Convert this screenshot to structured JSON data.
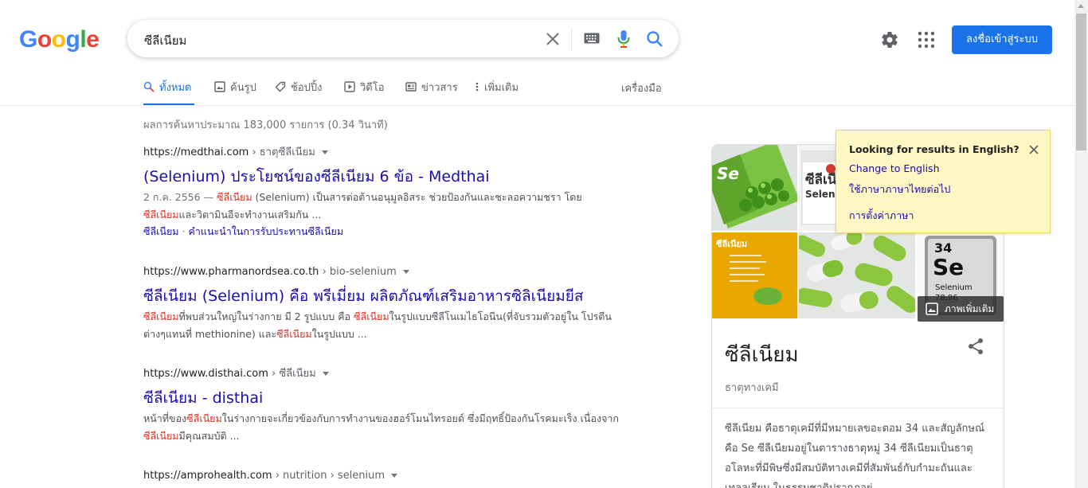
{
  "header": {
    "logo": [
      "G",
      "o",
      "o",
      "g",
      "l",
      "e"
    ],
    "logo_colors": [
      "#4285f4",
      "#ea4335",
      "#fbbc05",
      "#4285f4",
      "#34a853",
      "#ea4335"
    ],
    "query": "ซีลีเนียม",
    "signin_label": "ลงชื่อเข้าสู่ระบบ",
    "accent": "#1a73e8"
  },
  "tabs": {
    "all": "ทั้งหมด",
    "images": "ค้นรูป",
    "shopping": "ช้อปปิ้ง",
    "videos": "วิดีโอ",
    "news": "ข่าวสาร",
    "more": "เพิ่มเติม",
    "tools": "เครื่องมือ"
  },
  "stats": "ผลการค้นหาประมาณ 183,000 รายการ (0.34 วินาที)",
  "results": [
    {
      "url": "https://medthai.com",
      "crumb": "› ธาตุซีลีเนียม",
      "title": "(Selenium) ประโยชน์ของซีลีเนียม 6 ข้อ - Medthai",
      "date": "2 ก.ค. 2556 —",
      "s1": "ซีลีเนียม",
      "s2": " (Selenium) เป็นสารต่อต้านอนุมูลอิสระ ช่วยป้องกันและชะลอความชรา โดย ",
      "s3": "ซีลีเนียม",
      "s4": "และวิตามินอีจะทำงานเสริมกัน ...",
      "link1": "ซีลีเนียม",
      "link_sep": "·",
      "link2": "คำแนะนำในการรับประทานซีลีเนียม"
    },
    {
      "url": "https://www.pharmanordsea.co.th",
      "crumb": "› bio-selenium",
      "title": "ซีลีเนียม (Selenium) คือ พรีเมี่ยม ผลิตภัณฑ์เสริมอาหารซิลิเนียมยีส",
      "s1": "ซีลีเนียม",
      "s2": "ที่พบส่วนใหญ่ในร่างกาย มี 2 รูปแบบ คือ ",
      "s3": "ซีลีเนียม",
      "s4": "ในรูปแบบซีลีโนเมไธโอนีน(ที่จับรวมตัวอยู่ใน โปรตีนต่างๆแทนที่ methionine) และ",
      "s5": "ซีลีเนียม",
      "s6": "ในรูปแบบ ..."
    },
    {
      "url": "https://www.disthai.com",
      "crumb": "› ซีลีเนียม",
      "title": "ซีลีเนียม - disthai",
      "s1": "หน้าที่ของ",
      "s2": "ซีลีเนียม",
      "s3": "ในร่างกายจะเกี่ยวข้องกับการทำงานของฮอร์โมนไทรอยด์ ซึ่งมีฤทธิ์ป้องกันโรคมะเร็ง เนื่องจาก",
      "s4": "ซีลีเนียม",
      "s5": "มีคุณสมบัติ ..."
    },
    {
      "url": "https://amprohealth.com",
      "crumb": "› nutrition › selenium"
    }
  ],
  "knowledge_panel": {
    "title": "ซีลีเนียม",
    "subtitle": "ธาตุทางเคมี",
    "more_images": "ภาพเพิ่มเติม",
    "img_se_pill": "Se",
    "img_box": "ซีลีเนีย",
    "img_box2": "Seleni",
    "img_yellow": "ซีลีเนียม",
    "tile_number": "34",
    "tile_symbol": "Se",
    "tile_name": "Selenium",
    "tile_mass": "78.96",
    "description": "ซีลีเนียม คือธาตุเคมีที่มีหมายเลขอะตอม 34 และสัญลักษณ์คือ Se ซีลีเนียมอยู่ในตารางธาตุหมู่ 34 ซีลีเนียมเป็นธาตุอโลหะที่มีพิษซึ่งมีสมบัติทางเคมีที่สัมพันธ์กับกำมะถันและเทลลูเรียม ในธรรมชาติปรากฏอยู่"
  },
  "lang_popup": {
    "title": "Looking for results in English?",
    "change": "Change to English",
    "keep": "ใช้ภาษาภาษาไทยต่อไป",
    "settings": "การตั้งค่าภาษา"
  }
}
